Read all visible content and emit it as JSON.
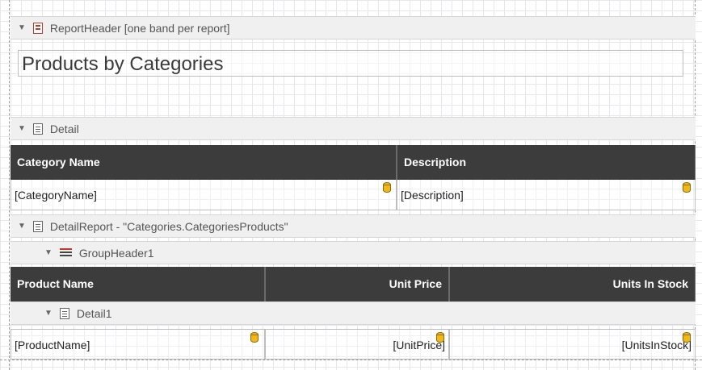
{
  "bands": {
    "report_header": "ReportHeader [one band per report]",
    "detail": "Detail",
    "detail_report": "DetailReport - \"Categories.CategoriesProducts\"",
    "group_header": "GroupHeader1",
    "detail1": "Detail1"
  },
  "report_title": "Products by Categories",
  "category_table": {
    "headers": [
      "Category Name",
      "Description"
    ],
    "fields": [
      "[CategoryName]",
      "[Description]"
    ]
  },
  "product_table": {
    "headers": [
      "Product Name",
      "Unit Price",
      "Units In Stock"
    ],
    "fields": [
      "[ProductName]",
      "[UnitPrice]",
      "[UnitsInStock]"
    ]
  },
  "icons": {
    "report_header": "report-band-icon",
    "detail": "detail-band-icon",
    "group_header": "group-header-icon",
    "field_binding": "database-icon"
  },
  "colors": {
    "table_header_bg": "#3c3c3c",
    "band_bg": "#f0f0f0",
    "binding_icon": "#f2b81a"
  }
}
